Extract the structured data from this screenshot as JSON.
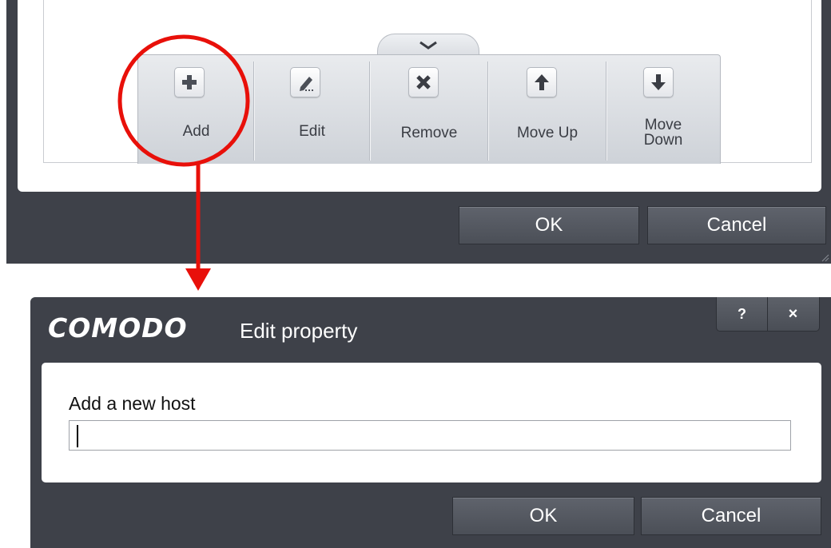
{
  "parent_window": {
    "toolbar": {
      "buttons": [
        {
          "label": "Add",
          "icon": "plus-icon"
        },
        {
          "label": "Edit",
          "icon": "pencil-icon"
        },
        {
          "label": "Remove",
          "icon": "x-icon"
        },
        {
          "label": "Move Up",
          "icon": "arrow-up-icon"
        },
        {
          "label": "Move Down",
          "label_line1": "Move",
          "label_line2": "Down",
          "icon": "arrow-down-icon"
        }
      ],
      "collapse_icon": "chevron-down-icon"
    },
    "ok_label": "OK",
    "cancel_label": "Cancel"
  },
  "annotation": {
    "color": "#e8100a",
    "highlight": "Add"
  },
  "dialog": {
    "brand": "COMODO",
    "title": "Edit property",
    "help_label": "?",
    "close_label": "×",
    "field_label": "Add a new host",
    "field_value": "",
    "ok_label": "OK",
    "cancel_label": "Cancel"
  },
  "colors": {
    "window_bg": "#3e4149",
    "panel_bg": "#ffffff",
    "button_bg": "#52565e",
    "toolbar_bg": "#dcdfe3"
  }
}
